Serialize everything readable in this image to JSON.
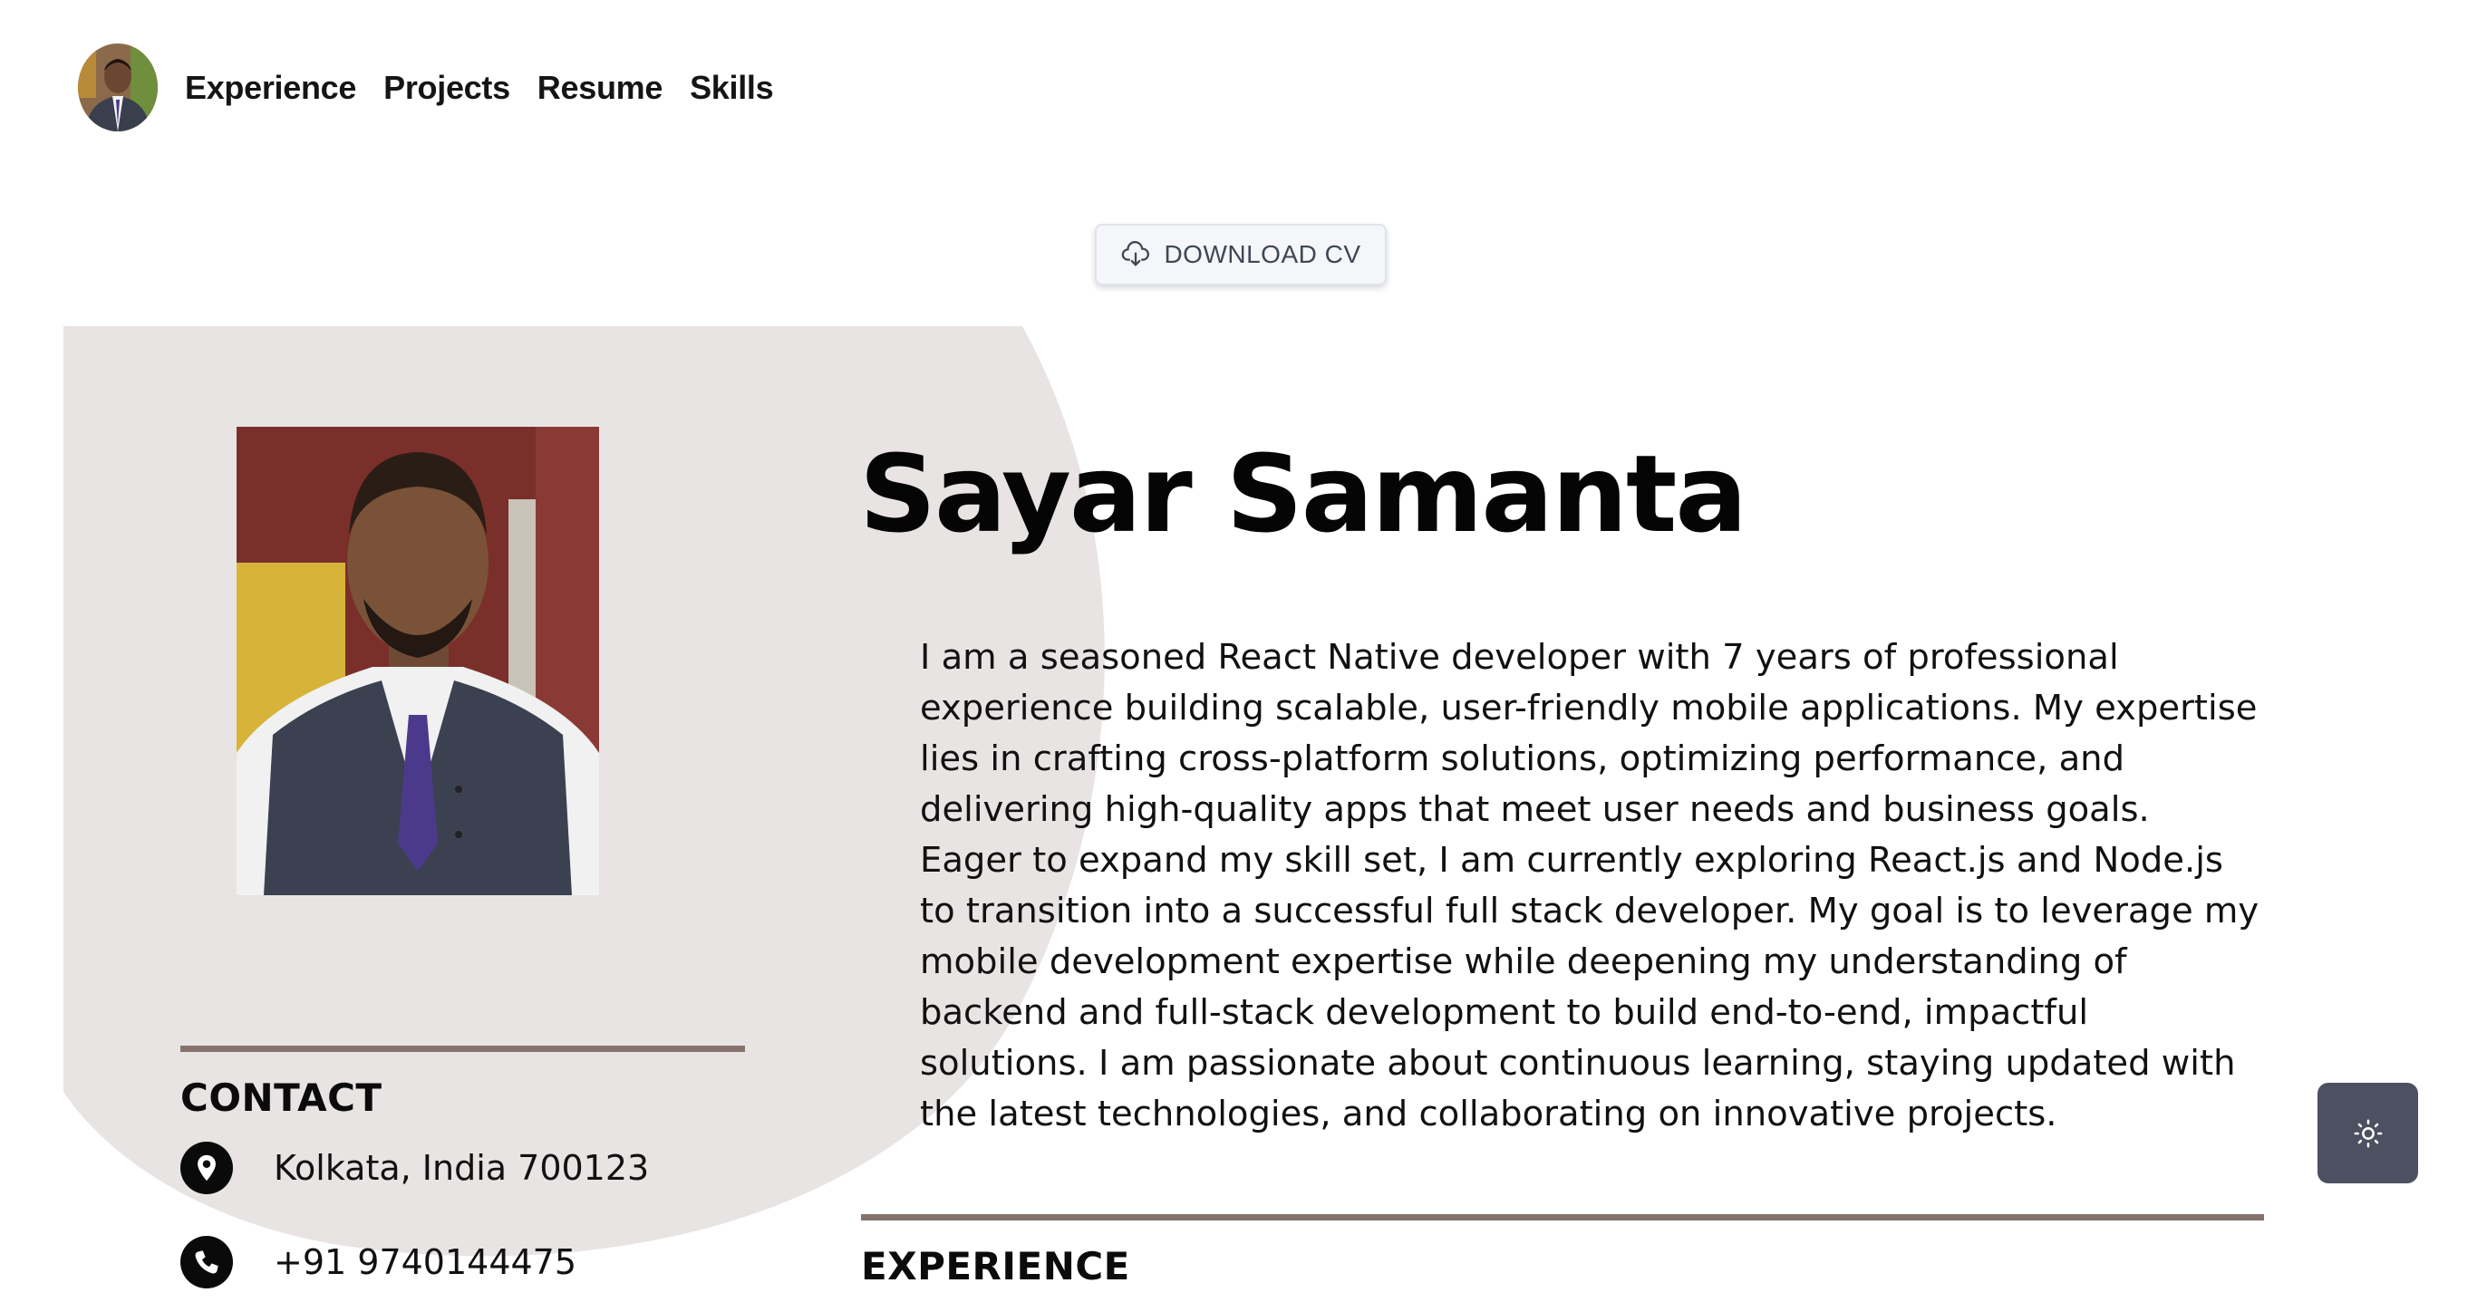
{
  "nav": {
    "avatar_icon": "profile-avatar",
    "links": [
      "Experience",
      "Projects",
      "Resume",
      "Skills"
    ]
  },
  "download": {
    "label": "DOWNLOAD CV",
    "icon": "cloud-download-icon"
  },
  "profile": {
    "name": "Sayar Samanta",
    "about": [
      "I am a seasoned React Native developer with 7 years of professional experience building scalable, user-friendly mobile applications. My expertise lies in crafting cross-platform solutions, optimizing performance, and delivering high-quality apps that meet user needs and business goals.",
      "Eager to expand my skill set, I am currently exploring React.js and Node.js to transition into a successful full stack developer. My goal is to leverage my mobile development expertise while deepening my understanding of backend and full-stack development to build end-to-end, impactful solutions. I am passionate about continuous learning, staying updated with the latest technologies, and collaborating on innovative projects."
    ]
  },
  "contact": {
    "heading": "CONTACT",
    "items": [
      {
        "icon": "location-pin-icon",
        "text": "Kolkata, India 700123"
      },
      {
        "icon": "phone-icon",
        "text": "+91 9740144475"
      }
    ]
  },
  "experience": {
    "heading": "EXPERIENCE"
  },
  "theme_toggle": {
    "icon": "sun-icon"
  },
  "colors": {
    "panel_bg": "#e8e4e3",
    "rule": "#86736d",
    "toggle_bg": "#4c5061",
    "button_bg": "#f4f6f9"
  }
}
